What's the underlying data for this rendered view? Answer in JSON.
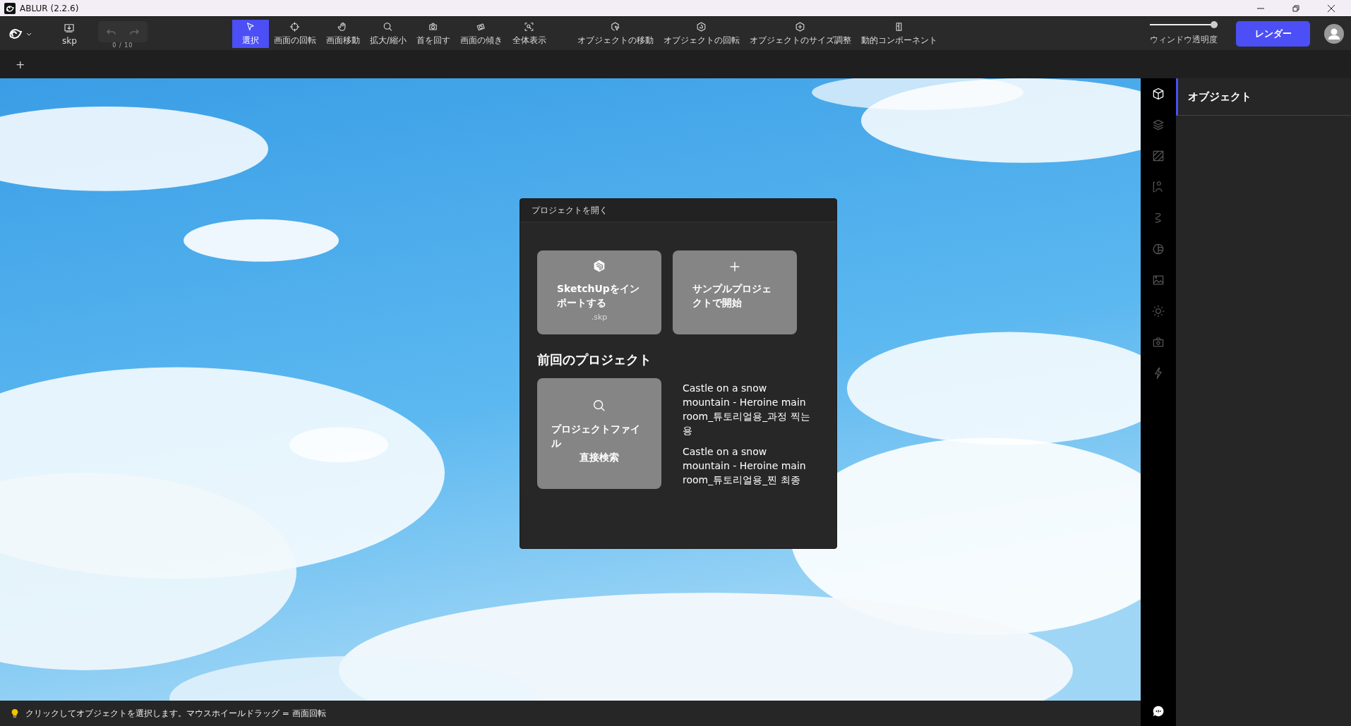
{
  "window": {
    "title": "ABLUR (2.2.6)"
  },
  "toolbar": {
    "file_label": "skp",
    "history": {
      "buttons": [
        {
          "disabled": true
        },
        {
          "disabled": true
        }
      ],
      "counter": "0 / 10"
    },
    "tools": [
      {
        "label": "選択",
        "selected": true
      },
      {
        "label": "画面の回転",
        "selected": false
      },
      {
        "label": "画面移動",
        "selected": false
      },
      {
        "label": "拡大/縮小",
        "selected": false
      },
      {
        "label": "首を回す",
        "selected": false
      },
      {
        "label": "画面の傾き",
        "selected": false
      },
      {
        "label": "全体表示",
        "selected": false
      },
      {
        "label": "オブジェクトの移動",
        "selected": false
      },
      {
        "label": "オブジェクトの回転",
        "selected": false
      },
      {
        "label": "オブジェクトのサイズ調整",
        "selected": false
      },
      {
        "label": "動的コンポーネント",
        "selected": false
      }
    ],
    "opacity_slider": {
      "label": "ウィンドウ透明度",
      "level": 1
    },
    "render_button": "レンダー"
  },
  "tab_bar": {
    "add": "+"
  },
  "dialog": {
    "title": "プロジェクトを開く",
    "actions": [
      {
        "kind": "import",
        "label": "SketchUpをインポートする",
        "sub": ".skp"
      },
      {
        "kind": "sample",
        "label": "サンプルプロジェクトで開始"
      }
    ],
    "recent_heading": "前回のプロジェクト",
    "search_card": {
      "label": "プロジェクトファイル",
      "sub": "直接検索"
    },
    "recent": [
      "Castle on a snow mountain - Heroine main room_튜토리얼용_과정 찍는 용",
      "Castle on a snow mountain - Heroine main room_튜토리얼용_찐 최종"
    ]
  },
  "rail": [
    {
      "selected": true
    },
    {
      "selected": false
    },
    {
      "selected": false
    },
    {
      "selected": false
    },
    {
      "selected": false
    },
    {
      "selected": false
    },
    {
      "selected": false
    },
    {
      "selected": false
    },
    {
      "selected": false
    },
    {
      "selected": false
    }
  ],
  "panel": {
    "title": "オブジェクト"
  },
  "status_bar": {
    "hint": "クリックしてオブジェクトを選択します。マウスホイールドラッグ = 画面回転"
  }
}
